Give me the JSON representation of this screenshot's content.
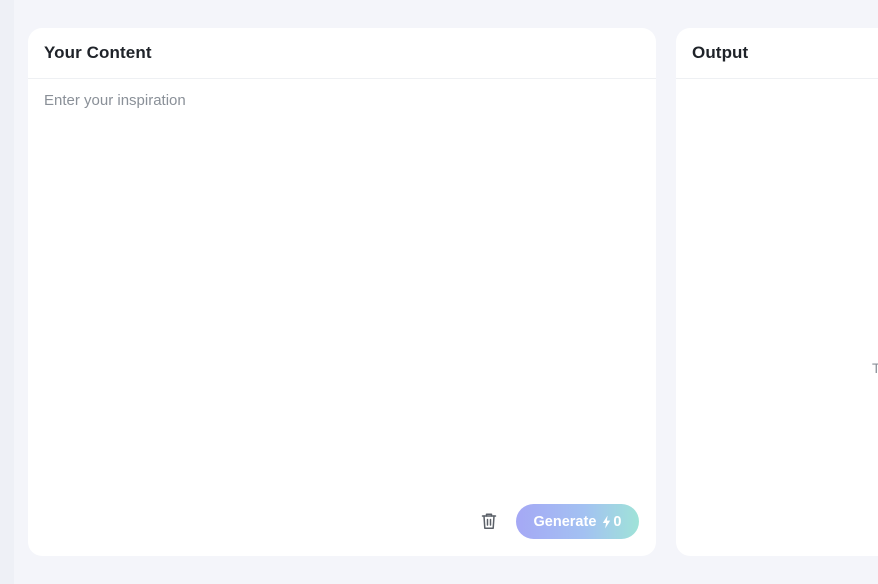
{
  "content_panel": {
    "title": "Your Content",
    "input": {
      "value": "",
      "placeholder": "Enter your inspiration"
    },
    "actions": {
      "delete_icon": "trash-icon",
      "generate_label": "Generate",
      "generate_icon": "lightning-bolt-icon",
      "credit_count": "0"
    }
  },
  "output_panel": {
    "title": "Output",
    "hint_text_visible": "T"
  },
  "colors": {
    "background": "#f4f5fa",
    "panel": "#ffffff",
    "title_text": "#1f2329",
    "placeholder_text": "#8a9098",
    "generate_gradient_start": "#a5a8f5",
    "generate_gradient_end": "#9fe3d8"
  }
}
